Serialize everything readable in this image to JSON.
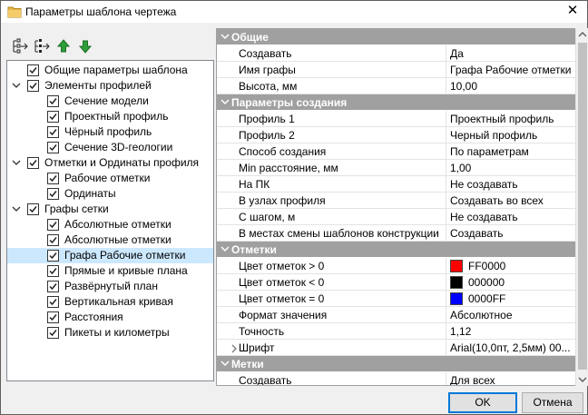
{
  "window": {
    "title": "Параметры шаблона чертежа",
    "close_glyph": "✕"
  },
  "toolbar": {
    "icons": [
      "expand-all-icon",
      "collapse-all-icon",
      "move-up-icon",
      "move-down-icon"
    ]
  },
  "tree": {
    "items": [
      {
        "label": "Общие параметры шаблона",
        "level": 0,
        "expandable": false,
        "checked": true,
        "selected": false
      },
      {
        "label": "Элементы профилей",
        "level": 0,
        "expandable": true,
        "checked": true,
        "selected": false
      },
      {
        "label": "Сечение модели",
        "level": 1,
        "expandable": false,
        "checked": true,
        "selected": false
      },
      {
        "label": "Проектный профиль",
        "level": 1,
        "expandable": false,
        "checked": true,
        "selected": false
      },
      {
        "label": "Чёрный профиль",
        "level": 1,
        "expandable": false,
        "checked": true,
        "selected": false
      },
      {
        "label": "Сечение 3D-геологии",
        "level": 1,
        "expandable": false,
        "checked": true,
        "selected": false
      },
      {
        "label": "Отметки и Ординаты профиля",
        "level": 0,
        "expandable": true,
        "checked": true,
        "selected": false
      },
      {
        "label": "Рабочие отметки",
        "level": 1,
        "expandable": false,
        "checked": true,
        "selected": false
      },
      {
        "label": "Ординаты",
        "level": 1,
        "expandable": false,
        "checked": true,
        "selected": false
      },
      {
        "label": "Графы сетки",
        "level": 0,
        "expandable": true,
        "checked": true,
        "selected": false
      },
      {
        "label": "Абсолютные отметки",
        "level": 1,
        "expandable": false,
        "checked": true,
        "selected": false
      },
      {
        "label": "Абсолютные отметки",
        "level": 1,
        "expandable": false,
        "checked": true,
        "selected": false
      },
      {
        "label": "Графа Рабочие отметки",
        "level": 1,
        "expandable": false,
        "checked": true,
        "selected": true
      },
      {
        "label": "Прямые и кривые плана",
        "level": 1,
        "expandable": false,
        "checked": true,
        "selected": false
      },
      {
        "label": "Развёрнутый план",
        "level": 1,
        "expandable": false,
        "checked": true,
        "selected": false
      },
      {
        "label": "Вертикальная кривая",
        "level": 1,
        "expandable": false,
        "checked": true,
        "selected": false
      },
      {
        "label": "Расстояния",
        "level": 1,
        "expandable": false,
        "checked": true,
        "selected": false
      },
      {
        "label": "Пикеты и километры",
        "level": 1,
        "expandable": false,
        "checked": true,
        "selected": false
      }
    ]
  },
  "grid": {
    "rows": [
      {
        "type": "category",
        "label": "Общие"
      },
      {
        "type": "prop",
        "name": "Создавать",
        "value": "Да"
      },
      {
        "type": "prop",
        "name": "Имя графы",
        "value": "Графа Рабочие отметки"
      },
      {
        "type": "prop",
        "name": "Высота, мм",
        "value": "10,00"
      },
      {
        "type": "category",
        "label": "Параметры создания"
      },
      {
        "type": "prop",
        "name": "Профиль 1",
        "value": "Проектный профиль"
      },
      {
        "type": "prop",
        "name": "Профиль 2",
        "value": "Черный профиль"
      },
      {
        "type": "prop",
        "name": "Способ создания",
        "value": "По параметрам"
      },
      {
        "type": "prop",
        "name": "Min расстояние, мм",
        "value": "1,00"
      },
      {
        "type": "prop",
        "name": "На ПК",
        "value": "Не создавать"
      },
      {
        "type": "prop",
        "name": "В узлах профиля",
        "value": "Создавать во всех"
      },
      {
        "type": "prop",
        "name": "С шагом, м",
        "value": "Не создавать"
      },
      {
        "type": "prop",
        "name": "В местах смены шаблонов конструкции",
        "value": "Создавать"
      },
      {
        "type": "category",
        "label": "Отметки"
      },
      {
        "type": "color",
        "name": "Цвет отметок > 0",
        "value": "FF0000",
        "color": "#ff0000"
      },
      {
        "type": "color",
        "name": "Цвет отметок < 0",
        "value": "000000",
        "color": "#000000"
      },
      {
        "type": "color",
        "name": "Цвет отметок = 0",
        "value": "0000FF",
        "color": "#0000ff"
      },
      {
        "type": "prop",
        "name": "Формат значения",
        "value": "Абсолютное"
      },
      {
        "type": "prop",
        "name": "Точность",
        "value": "1,12"
      },
      {
        "type": "expandable",
        "name": "Шрифт",
        "value": "Arial(10,0пт, 2,5мм) 00..."
      },
      {
        "type": "category",
        "label": "Метки"
      },
      {
        "type": "prop",
        "name": "Создавать",
        "value": "Для всех"
      }
    ]
  },
  "buttons": {
    "ok": "OK",
    "cancel": "Отмена"
  },
  "colors": {
    "selection": "#cce8ff",
    "category_bg": "#a0a0a0",
    "accent": "#0078d7"
  }
}
